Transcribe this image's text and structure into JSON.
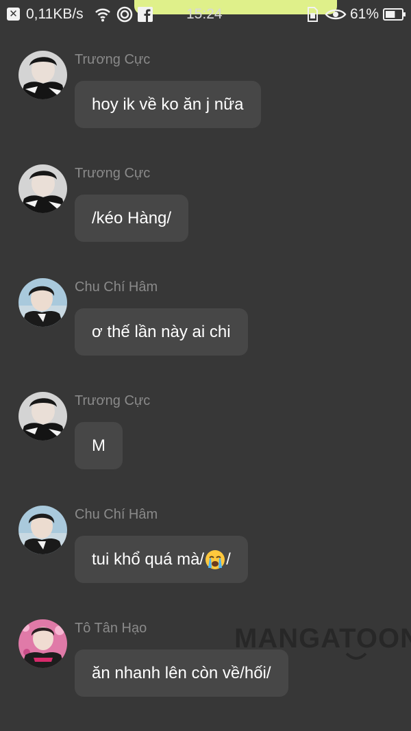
{
  "status_bar": {
    "net_speed": "0,11KB/s",
    "time": "15:24",
    "battery_percent": "61%",
    "battery_level": 0.61,
    "icons": [
      "close-box-icon",
      "wifi-icon",
      "circle-icon",
      "facebook-icon",
      "sim-icon",
      "eye-icon",
      "battery-icon"
    ]
  },
  "messages": [
    {
      "sender": "Trương Cực",
      "avatar": "avatar-truong-cuc",
      "text": "hoy ik về ko ăn j nữa"
    },
    {
      "sender": "Trương Cực",
      "avatar": "avatar-truong-cuc",
      "text": "/kéo Hàng/"
    },
    {
      "sender": "Chu Chí Hâm",
      "avatar": "avatar-chu-chi-ham",
      "text": "ơ thế lần này ai chi"
    },
    {
      "sender": "Trương Cực",
      "avatar": "avatar-truong-cuc",
      "text": "M"
    },
    {
      "sender": "Chu Chí Hâm",
      "avatar": "avatar-chu-chi-ham",
      "text_before": "tui khổ quá mà/",
      "emoji": "loudly-crying-face-icon",
      "text_after": "/"
    },
    {
      "sender": "Tô Tân Hạo",
      "avatar": "avatar-to-tan-hao",
      "text": "ăn nhanh lên còn về/hối/"
    }
  ],
  "watermark": {
    "text": "MANGATOON"
  },
  "colors": {
    "background": "#373737",
    "bubble": "#474747",
    "sender_name": "#8a8a8a",
    "status_pill": "#dff08a"
  }
}
